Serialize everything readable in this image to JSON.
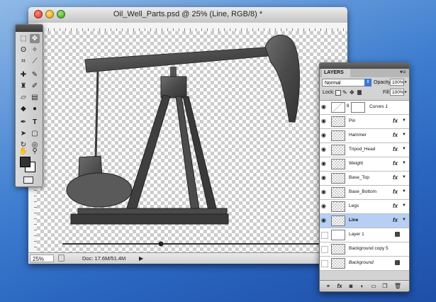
{
  "document": {
    "title": "Oil_Well_Parts.psd @ 25% (Line, RGB/8) *",
    "zoom": "25%",
    "doc_info": "Doc: 17.6M/51.4M"
  },
  "tools": {
    "items": [
      "marquee-tool",
      "move-tool",
      "lasso-tool",
      "magic-wand-tool",
      "crop-tool",
      "eyedropper-tool",
      "healing-brush-tool",
      "brush-tool",
      "clone-stamp-tool",
      "history-brush-tool",
      "eraser-tool",
      "gradient-tool",
      "blur-tool",
      "dodge-tool",
      "pen-tool",
      "type-tool",
      "path-selection-tool",
      "shape-tool",
      "3d-rotate-tool",
      "3d-orbit-tool",
      "hand-tool",
      "zoom-tool"
    ]
  },
  "layers_panel": {
    "tab_label": "LAYERS",
    "blend_mode": "Normal",
    "opacity_label": "Opacity:",
    "opacity_value": "100%",
    "lock_label": "Lock:",
    "fill_label": "Fill:",
    "fill_value": "100%",
    "rows": [
      {
        "name": "Curves 1",
        "type": "adjustment"
      },
      {
        "name": "Pin",
        "fx": "fx"
      },
      {
        "name": "Hammer",
        "fx": "fx"
      },
      {
        "name": "Tripod_Head",
        "fx": "fx"
      },
      {
        "name": "Weight",
        "fx": "fx"
      },
      {
        "name": "Base_Top",
        "fx": "fx"
      },
      {
        "name": "Base_Bottom",
        "fx": "fx"
      },
      {
        "name": "Legs",
        "fx": "fx"
      },
      {
        "name": "Line",
        "fx": "fx",
        "selected": true
      },
      {
        "name": "Layer 1",
        "locked": true
      },
      {
        "name": "Background copy 5"
      },
      {
        "name": "Background",
        "locked": true
      }
    ]
  },
  "colors": {
    "selection": "#b6cff3",
    "accent": "#3a78d8"
  }
}
